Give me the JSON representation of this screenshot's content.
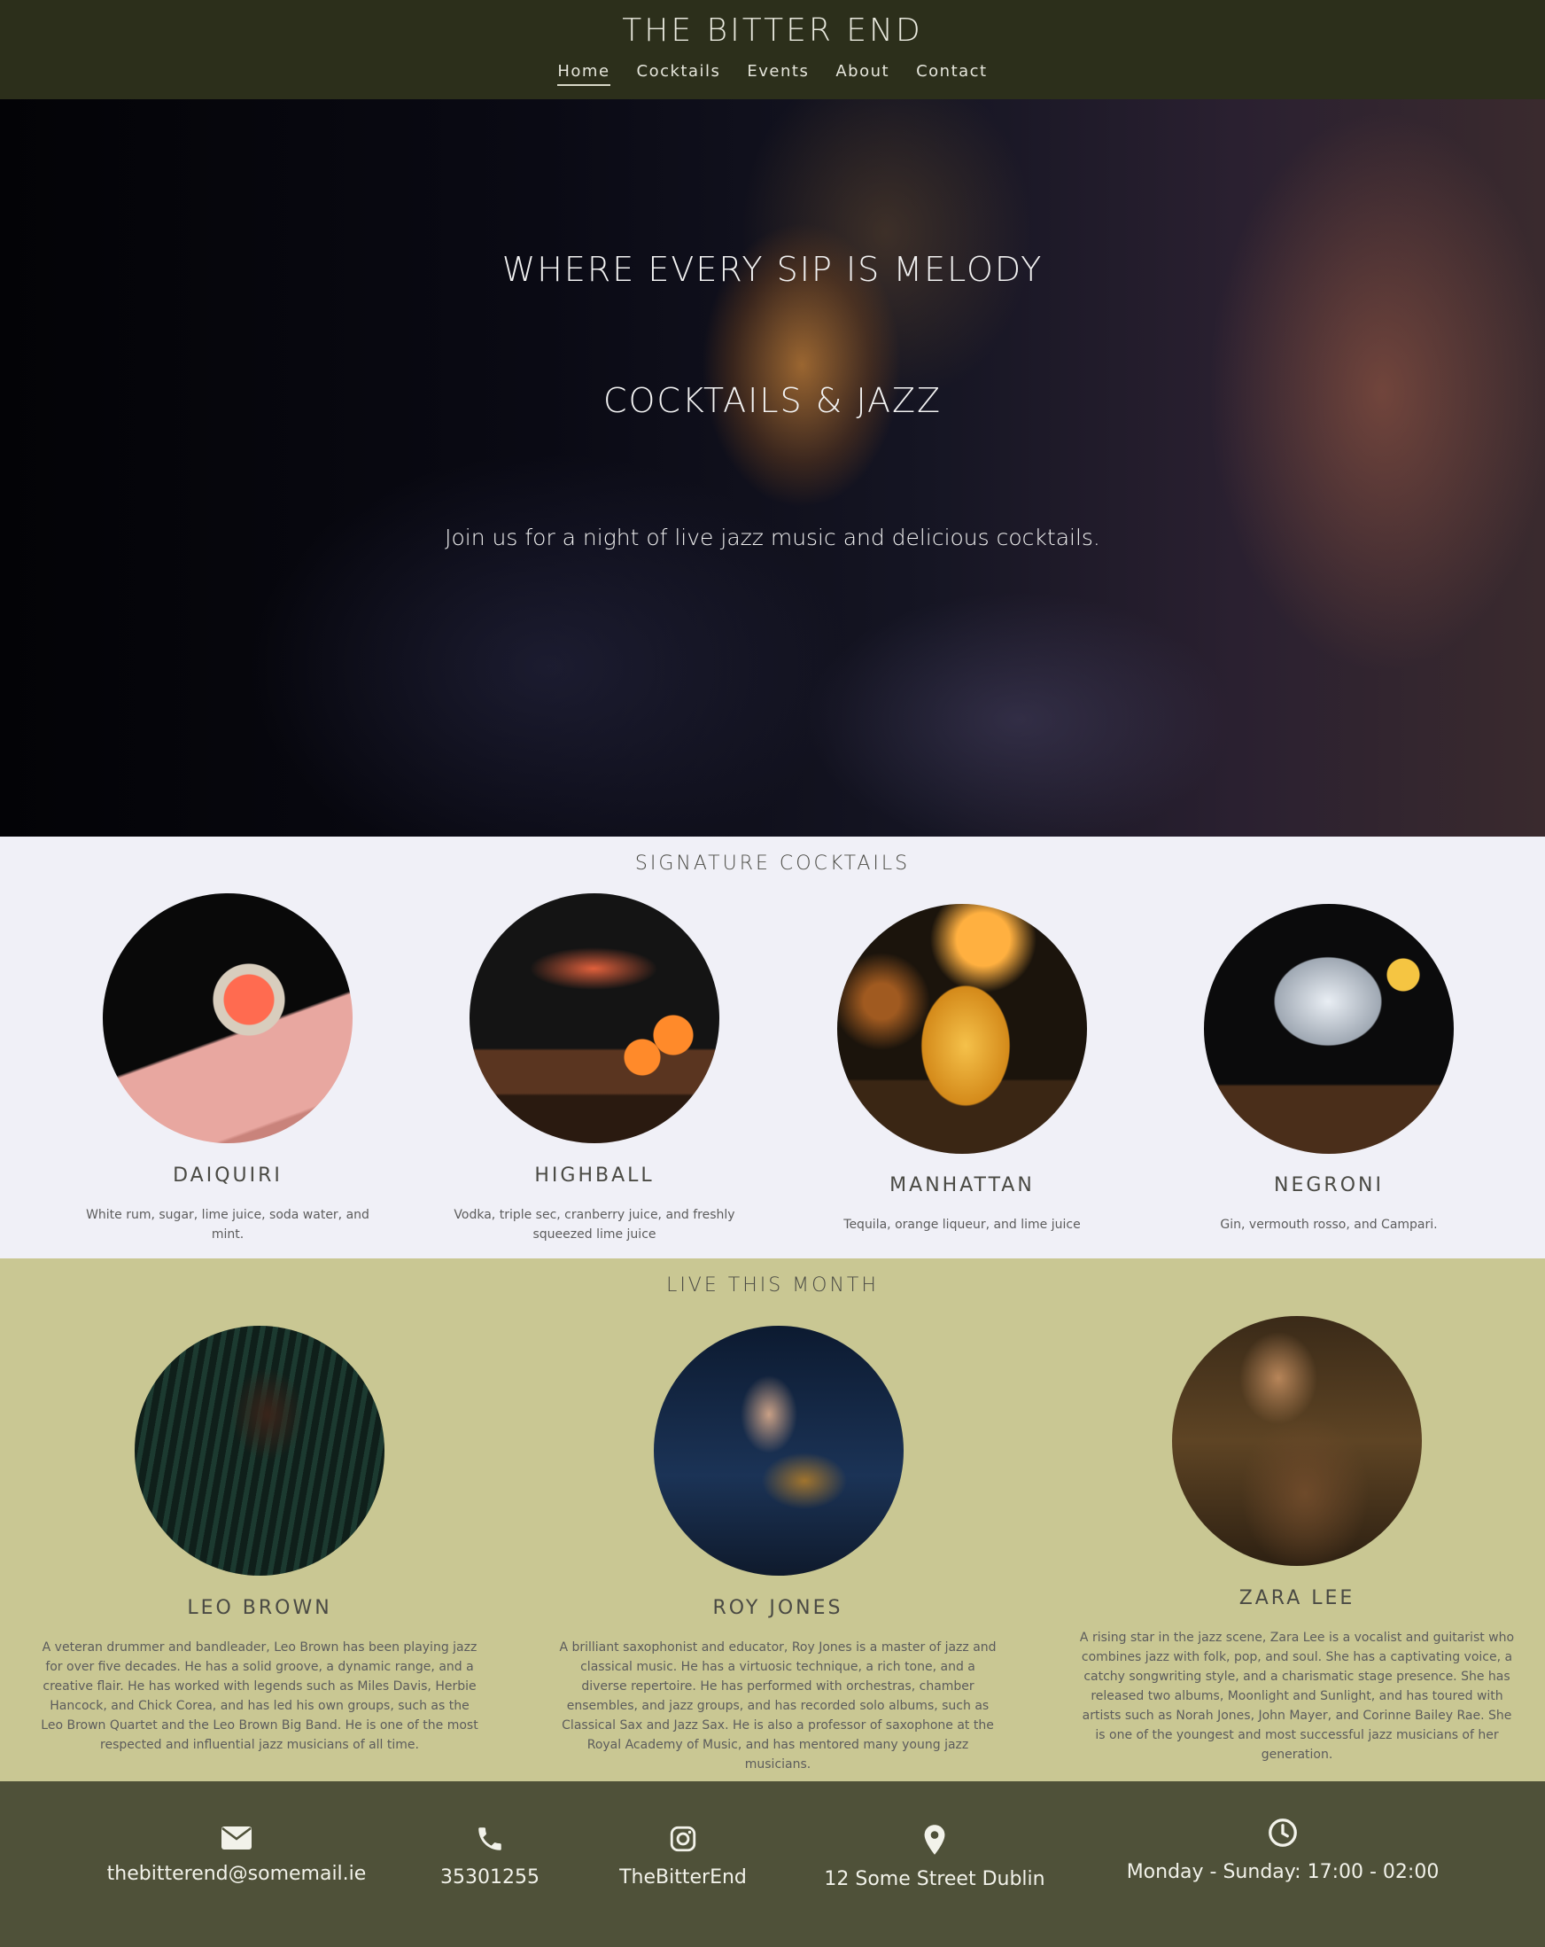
{
  "header": {
    "brand": "THE BITTER END",
    "nav": [
      "Home",
      "Cocktails",
      "Events",
      "About",
      "Contact"
    ]
  },
  "hero": {
    "title": "WHERE EVERY SIP IS MELODY",
    "subtitle": "COCKTAILS & JAZZ",
    "text": "Join us for a night of live jazz music and delicious cocktails."
  },
  "cocktails": {
    "title": "SIGNATURE COCKTAILS",
    "items": [
      {
        "name": "DAIQUIRI",
        "desc": "White rum, sugar, lime juice, soda water, and mint."
      },
      {
        "name": "HIGHBALL",
        "desc": "Vodka, triple sec, cranberry juice, and freshly squeezed lime juice"
      },
      {
        "name": "MANHATTAN",
        "desc": "Tequila, orange liqueur, and lime juice"
      },
      {
        "name": "NEGRONI",
        "desc": "Gin, vermouth rosso, and Campari."
      }
    ]
  },
  "live": {
    "title": "LIVE THIS MONTH",
    "musicians": [
      {
        "name": "LEO BROWN",
        "bio": "A veteran drummer and bandleader, Leo Brown has been playing jazz for over five decades. He has a solid groove, a dynamic range, and a creative flair. He has worked with legends such as Miles Davis, Herbie Hancock, and Chick Corea, and has led his own groups, such as the Leo Brown Quartet and the Leo Brown Big Band. He is one of the most respected and influential jazz musicians of all time."
      },
      {
        "name": "ROY JONES",
        "bio": "A brilliant saxophonist and educator, Roy Jones is a master of jazz and classical music. He has a virtuosic technique, a rich tone, and a diverse repertoire. He has performed with orchestras, chamber ensembles, and jazz groups, and has recorded solo albums, such as Classical Sax and Jazz Sax. He is also a professor of saxophone at the Royal Academy of Music, and has mentored many young jazz musicians."
      },
      {
        "name": "ZARA LEE",
        "bio": "A rising star in the jazz scene, Zara Lee is a vocalist and guitarist who combines jazz with folk, pop, and soul. She has a captivating voice, a catchy songwriting style, and a charismatic stage presence. She has released two albums, Moonlight and Sunlight, and has toured with artists such as Norah Jones, John Mayer, and Corinne Bailey Rae. She is one of the youngest and most successful jazz musicians of her generation."
      }
    ]
  },
  "footer": {
    "email": {
      "icon": "envelope-icon",
      "label": "thebitterend@somemail.ie"
    },
    "phone": {
      "icon": "phone-icon",
      "label": "35301255"
    },
    "instagram": {
      "icon": "instagram-icon",
      "label": "TheBitterEnd"
    },
    "location": {
      "icon": "map-pin-icon",
      "label": "12 Some Street Dublin"
    },
    "hours": {
      "icon": "clock-icon",
      "label": "Monday - Sunday: 17:00 - 02:00"
    }
  },
  "colors": {
    "header_bg": "#2c2f1b",
    "cocktails_bg": "#f0f0f7",
    "live_bg": "#c9c793",
    "footer_bg": "#4f5139"
  }
}
